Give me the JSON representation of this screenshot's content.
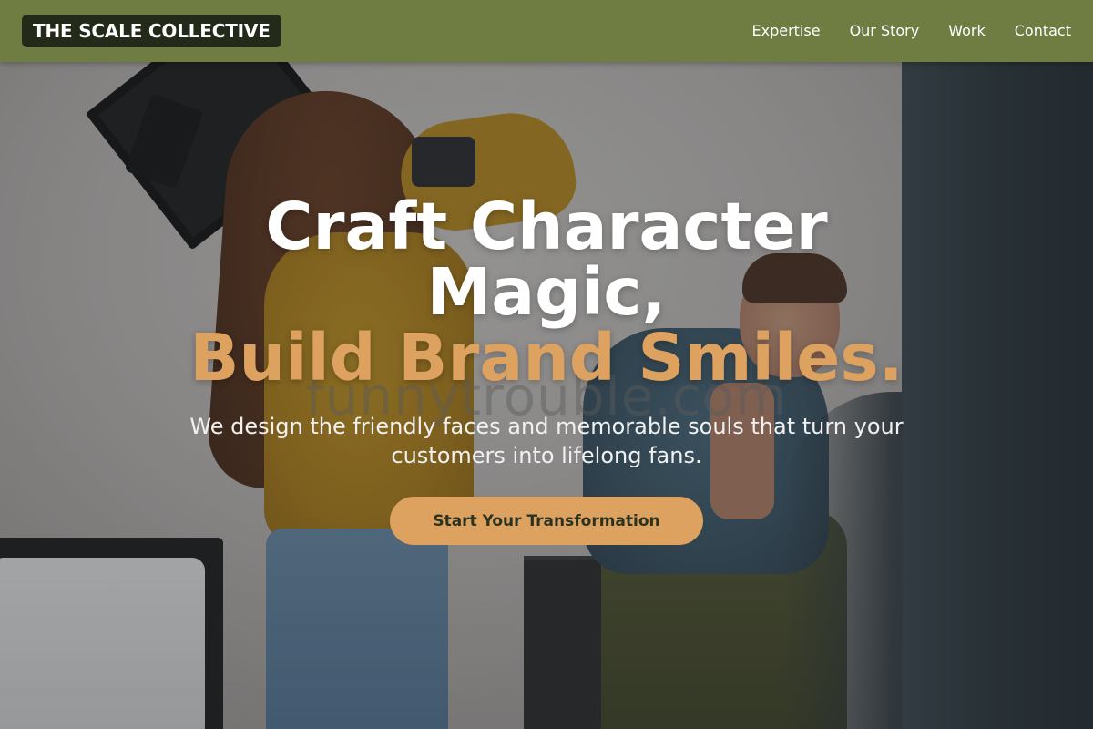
{
  "header": {
    "brand": "THE SCALE COLLECTIVE",
    "nav": [
      {
        "label": "Expertise"
      },
      {
        "label": "Our Story"
      },
      {
        "label": "Work"
      },
      {
        "label": "Contact"
      }
    ]
  },
  "hero": {
    "headline_line1": "Craft Character",
    "headline_line2": "Magic,",
    "headline_accent": "Build Brand Smiles.",
    "subtitle": "We design the friendly faces and memorable souls that turn your customers into lifelong fans.",
    "cta_label": "Start Your Transformation",
    "watermark": "funnytrouble.com"
  },
  "colors": {
    "header_bg": "#6f7d43",
    "brand_bg": "#232a1a",
    "accent": "#dda160",
    "cta_text": "#2b3320",
    "headline": "#ffffff"
  }
}
